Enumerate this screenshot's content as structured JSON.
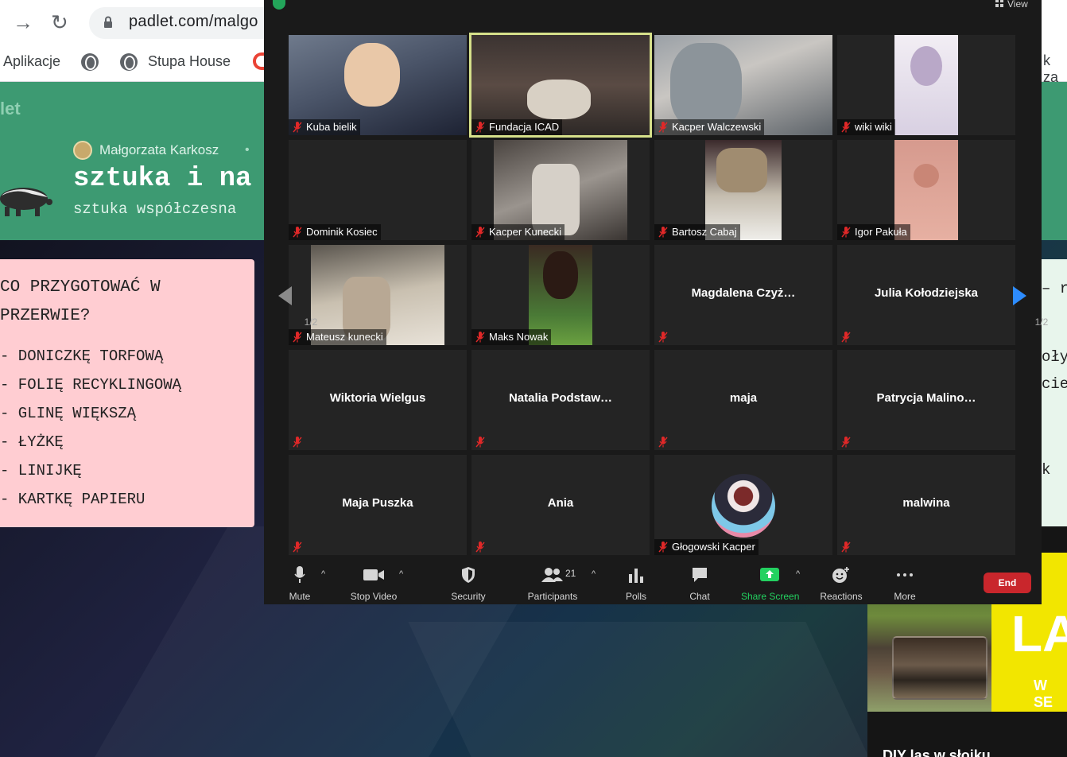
{
  "browser": {
    "url": "padlet.com/malgo",
    "bookmarks": [
      "Aplikacje",
      "Stupa House"
    ],
    "bookmark_right_fragment": "k za"
  },
  "padlet": {
    "logo_fragment": "let",
    "author": "Małgorzata Karkosz",
    "title": "sztuka i na",
    "subtitle": "sztuka współczesna",
    "card_title_lines": [
      "CO PRZYGOTOWAĆ W",
      "PRZERWIE?"
    ],
    "card_items": [
      "- DONICZKĘ TORFOWĄ",
      "- FOLIĘ RECYKLINGOWĄ",
      "- GLINĘ WIĘKSZĄ",
      "- ŁYŻKĘ",
      "- LINIJKĘ",
      "- KARTKĘ PAPIERU"
    ],
    "right_card_fragments": [
      "– r",
      "oły",
      "cie",
      "k"
    ],
    "image_card": {
      "overlay_text": "LA",
      "overlay_small": "W SE",
      "caption": "DIY las w słoiku"
    }
  },
  "zoom": {
    "view_label": "View",
    "page_indicator": "1/2",
    "participants": [
      {
        "name": "Kuba bielik",
        "video": true,
        "center": false
      },
      {
        "name": "Fundacja ICAD",
        "video": true,
        "center": false,
        "active": true
      },
      {
        "name": "Kacper Walczewski",
        "video": true,
        "center": false
      },
      {
        "name": "wiki wiki",
        "video": true,
        "center": false
      },
      {
        "name": "Dominik Kosiec",
        "video": false,
        "center": false
      },
      {
        "name": "Kacper Kunecki",
        "video": true,
        "center": false
      },
      {
        "name": "Bartosz Cabaj",
        "video": true,
        "center": false
      },
      {
        "name": "Igor Pakuła",
        "video": true,
        "center": false
      },
      {
        "name": "Mateusz kunecki",
        "video": true,
        "center": false
      },
      {
        "name": "Maks Nowak",
        "video": true,
        "center": false
      },
      {
        "name": "Magdalena  Czyż…",
        "video": false,
        "center": true
      },
      {
        "name": "Julia Kołodziejska",
        "video": false,
        "center": true
      },
      {
        "name": "Wiktoria Wielgus",
        "video": false,
        "center": true
      },
      {
        "name": "Natalia  Podstaw…",
        "video": false,
        "center": true
      },
      {
        "name": "maja",
        "video": false,
        "center": true
      },
      {
        "name": "Patrycja  Malino…",
        "video": false,
        "center": true
      },
      {
        "name": "Maja Puszka",
        "video": false,
        "center": true
      },
      {
        "name": "Ania",
        "video": false,
        "center": true
      },
      {
        "name": "Głogowski Kacper",
        "video": true,
        "center": false
      },
      {
        "name": "malwina",
        "video": false,
        "center": true
      }
    ],
    "toolbar": {
      "mute": "Mute",
      "stop_video": "Stop Video",
      "security": "Security",
      "participants": "Participants",
      "participants_count": "21",
      "polls": "Polls",
      "chat": "Chat",
      "share_screen": "Share Screen",
      "reactions": "Reactions",
      "more": "More",
      "end": "End"
    }
  }
}
